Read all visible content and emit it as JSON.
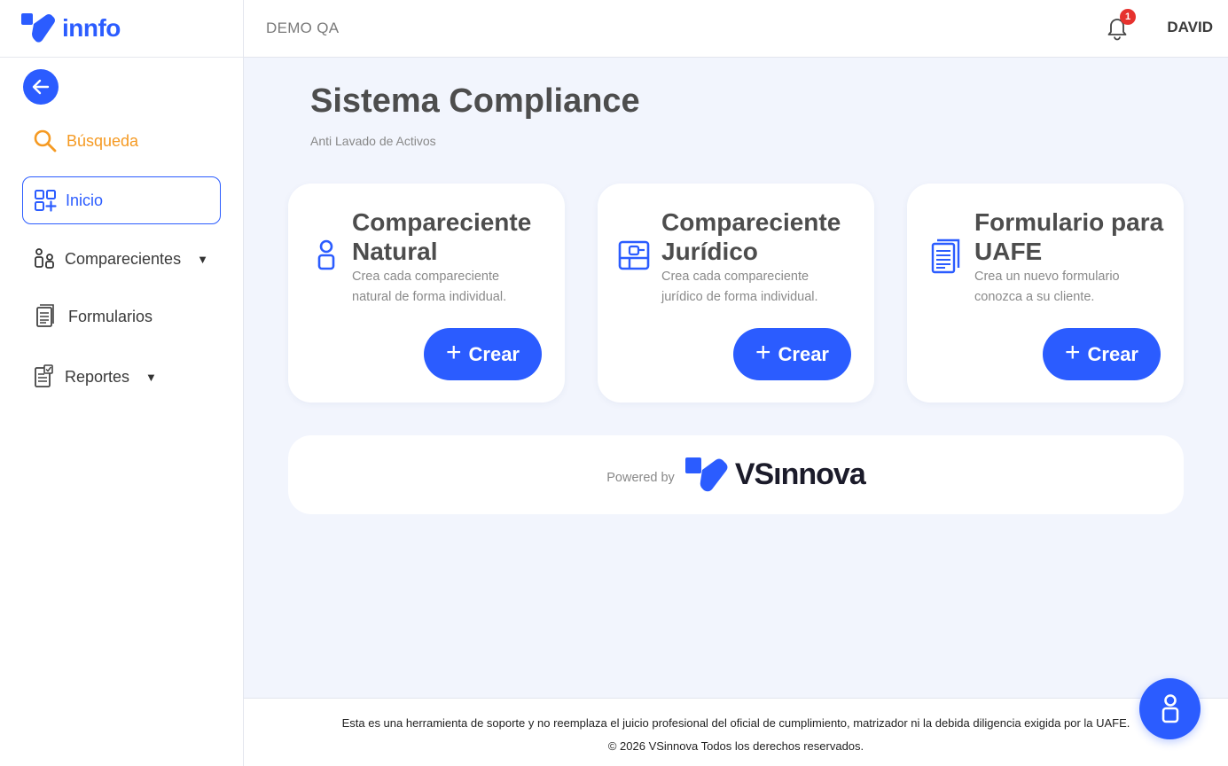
{
  "app": {
    "brand": "innfo",
    "environment": "DEMO QA",
    "user": "DAVID",
    "notifications_count": "1",
    "accent_color": "#2b5cff",
    "search_color": "#f59a23"
  },
  "sidebar": {
    "items": [
      {
        "label": "Búsqueda",
        "icon": "search-icon"
      },
      {
        "label": "Inicio",
        "icon": "grid-plus-icon"
      },
      {
        "label": "Comparecientes",
        "icon": "people-icon"
      },
      {
        "label": "Formularios",
        "icon": "document-icon"
      },
      {
        "label": "Reportes",
        "icon": "report-icon"
      }
    ]
  },
  "main": {
    "title": "Sistema Compliance",
    "subtitle": "Anti Lavado de Activos",
    "cards": [
      {
        "title": "Compareciente Natural",
        "description": "Crea cada compareciente natural de forma individual.",
        "button": "Crear",
        "icon": "person-icon"
      },
      {
        "title": "Compareciente Jurídico",
        "description": "Crea cada compareciente jurídico de forma individual.",
        "button": "Crear",
        "icon": "company-icon"
      },
      {
        "title": "Formulario para UAFE",
        "description": "Crea un nuevo formulario conozca a su cliente.",
        "button": "Crear",
        "icon": "form-icon"
      }
    ],
    "powered_by": "Powered by",
    "powered_brand": "VSınnova"
  },
  "footer": {
    "disclaimer": "Esta es una herramienta de soporte y no reemplaza el juicio profesional del oficial de cumplimiento, matrizador ni la debida diligencia exigida por la UAFE.",
    "copyright": "© 2026 VSinnova Todos los derechos reservados."
  }
}
